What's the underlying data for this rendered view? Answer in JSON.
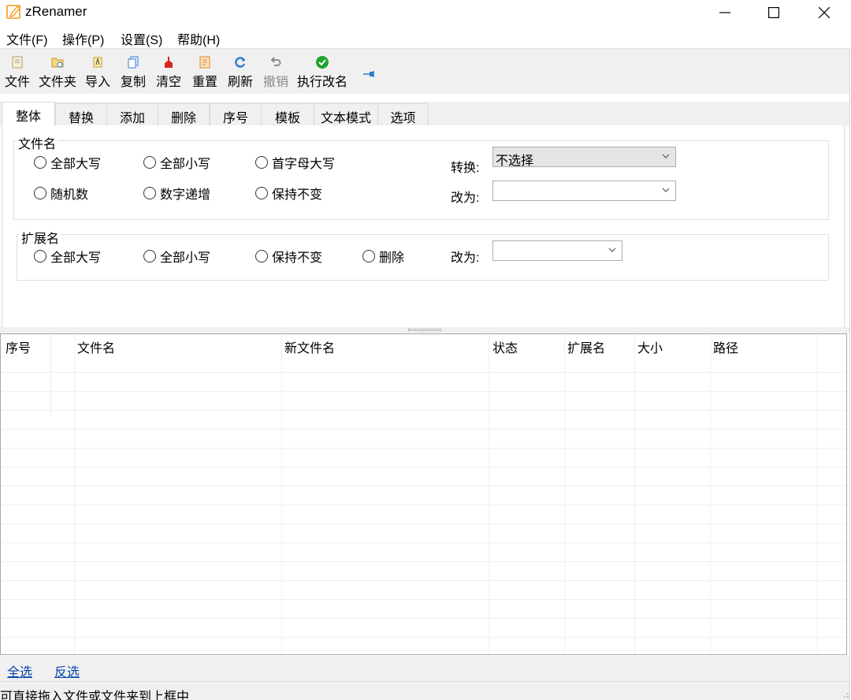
{
  "window": {
    "title": "zRenamer",
    "minimize_icon": "minimize-icon",
    "maximize_icon": "maximize-icon",
    "close_icon": "close-icon"
  },
  "menu": [
    "文件(F)",
    "操作(P)",
    "设置(S)",
    "帮助(H)"
  ],
  "toolbar": [
    {
      "label": "文件",
      "icon": "file-icon",
      "enabled": true
    },
    {
      "label": "文件夹",
      "icon": "folder-icon",
      "enabled": true
    },
    {
      "label": "导入",
      "icon": "import-icon",
      "enabled": true
    },
    {
      "label": "复制",
      "icon": "copy-icon",
      "enabled": true
    },
    {
      "label": "清空",
      "icon": "broom-icon",
      "enabled": true
    },
    {
      "label": "重置",
      "icon": "reset-icon",
      "enabled": true
    },
    {
      "label": "刷新",
      "icon": "refresh-icon",
      "enabled": true
    },
    {
      "label": "撤销",
      "icon": "undo-icon",
      "enabled": false
    },
    {
      "label": "执行改名",
      "icon": "check-icon",
      "enabled": true
    },
    {
      "label": "",
      "icon": "pin-icon",
      "enabled": true
    }
  ],
  "tabs": [
    "整体",
    "替换",
    "添加",
    "删除",
    "序号",
    "模板",
    "文本模式",
    "选项"
  ],
  "active_tab": "整体",
  "filename_group": {
    "title": "文件名",
    "options_row1": [
      "全部大写",
      "全部小写",
      "首字母大写"
    ],
    "options_row2": [
      "随机数",
      "数字递增",
      "保持不变"
    ],
    "convert_label": "转换:",
    "convert_value": "不选择",
    "change_label": "改为:",
    "change_value": ""
  },
  "extension_group": {
    "title": "扩展名",
    "options": [
      "全部大写",
      "全部小写",
      "保持不变",
      "删除"
    ],
    "change_label": "改为:",
    "change_value": ""
  },
  "list": {
    "columns": [
      "序号",
      "文件名",
      "新文件名",
      "状态",
      "扩展名",
      "大小",
      "路径"
    ]
  },
  "links": {
    "select_all": "全选",
    "invert": "反选"
  },
  "status": "可直接拖入文件或文件夹到上框中",
  "colors": {
    "toolbar_bg": "#f0f0f0",
    "link": "#0645ad",
    "check_green": "#1fa32c",
    "refresh_blue": "#2a7bd3",
    "broom_red": "#d9261c",
    "title_icon_orange": "#f39a1e"
  }
}
